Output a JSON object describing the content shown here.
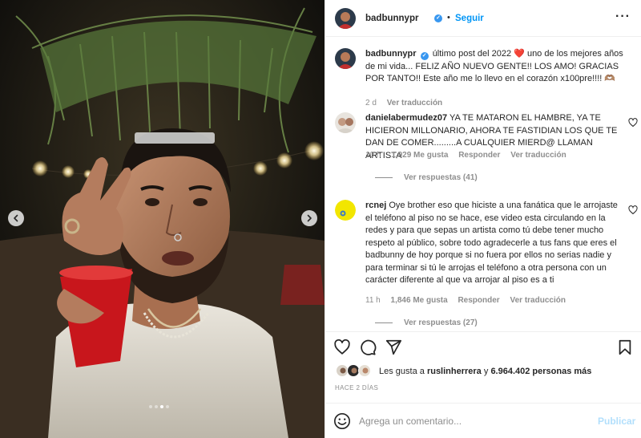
{
  "post": {
    "username": "badbunnypr",
    "follow_label": "Seguir",
    "separator": "•",
    "more_label": "···"
  },
  "caption": {
    "username": "badbunnypr",
    "text": "último post del 2022 ❤️ uno de los mejores años de mi vida... FELIZ AÑO NUEVO GENTE!! LOS AMO! GRACIAS POR TANTO!! Este año me lo llevo en el corazón x100pre!!!! 🫶🏽",
    "time": "2 d",
    "translate": "Ver traducción"
  },
  "comments": [
    {
      "username": "danielabermudez07",
      "text": "YA TE MATARON EL HAMBRE, YA TE HICIERON MILLONARIO, AHORA TE FASTIDIAN LOS QUE TE DAN DE COMER.........A CUALQUIER MIERD@ LLAMAN ARTISTA",
      "time": "10 h",
      "likes": "1,929 Me gusta",
      "reply": "Responder",
      "translate": "Ver traducción",
      "replies": "Ver respuestas (41)"
    },
    {
      "username": "rcnej",
      "text": "Oye brother eso que hiciste a una fanática que le arrojaste el teléfono al piso no se hace, ese video esta circulando en la redes y para que sepas un artista como tú debe tener mucho respeto al público, sobre todo agradecerle a tus fans que eres el badbunny de hoy porque si no fuera por ellos no serias nadie y para terminar si tú le arrojas el teléfono a otra persona con un carácter diferente al que va arrojar al piso es a ti",
      "time": "11 h",
      "likes": "1,846 Me gusta",
      "reply": "Responder",
      "translate": "Ver traducción",
      "replies": "Ver respuestas (27)"
    }
  ],
  "likes": {
    "prefix": "Les gusta a",
    "user": "ruslinherrera",
    "middle": "y",
    "count": "6.964.402 personas más"
  },
  "date": "HACE 2 DÍAS",
  "composer": {
    "placeholder": "Agrega un comentario...",
    "publish": "Publicar"
  },
  "carousel": {
    "total": 4,
    "active": 2
  },
  "colors": {
    "accent": "#0095f6",
    "verified": "#3897f0",
    "muted": "#8e8e8e",
    "publish_disabled": "#b2dffc",
    "heart": "#ed4956"
  },
  "icons": {
    "like": "heart-icon",
    "comment": "comment-icon",
    "share": "share-icon",
    "save": "bookmark-icon",
    "emoji": "emoji-icon"
  }
}
